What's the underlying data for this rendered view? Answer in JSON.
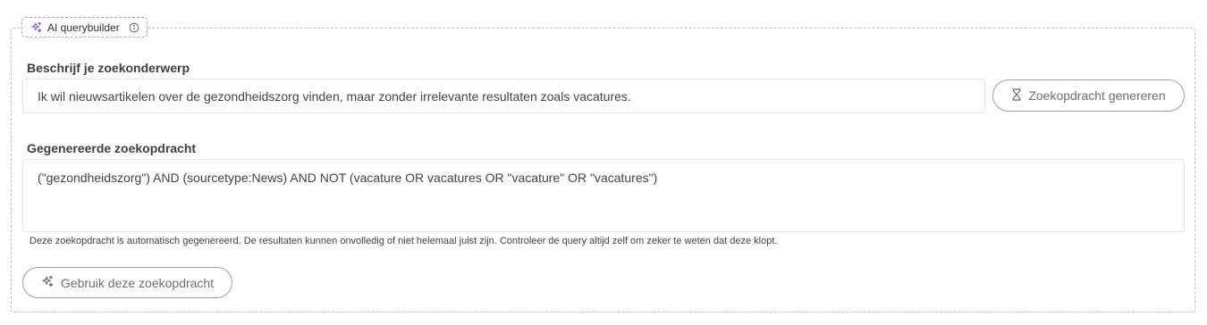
{
  "panel": {
    "title": "AI querybuilder",
    "title_icon": "sparkle-icon",
    "info_icon": "info-icon",
    "accent_color": "#b79be2"
  },
  "describe": {
    "label": "Beschrijf je zoekonderwerp",
    "value": "Ik wil nieuwsartikelen over de gezondheidszorg vinden, maar zonder irrelevante resultaten zoals vacatures."
  },
  "generate_button": {
    "label": "Zoekopdracht genereren",
    "icon": "hourglass-icon"
  },
  "generated": {
    "label": "Gegenereerde zoekopdracht",
    "value": "(\"gezondheidszorg\") AND (sourcetype:News) AND NOT (vacature OR vacatures OR \"vacature\" OR \"vacatures\")",
    "disclaimer": "Deze zoekopdracht is automatisch gegenereerd. De resultaten kunnen onvolledig of niet helemaal juist zijn. Controleer de query altijd zelf om zeker te weten dat deze klopt."
  },
  "use_button": {
    "label": "Gebruik deze zoekopdracht",
    "icon": "sparkle-icon"
  }
}
